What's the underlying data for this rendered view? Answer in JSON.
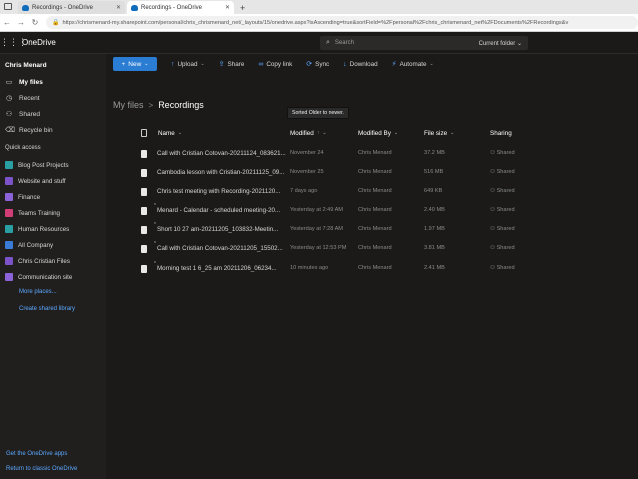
{
  "browser": {
    "tabs": [
      {
        "label": "Recordings - OneDrive",
        "active": false
      },
      {
        "label": "Recordings - OneDrive",
        "active": true
      }
    ],
    "new_tab": "+",
    "url": "https://chrismenard-my.sharepoint.com/personal/chris_chrismenard_net/_layouts/15/onedrive.aspx?isAscending=true&sortField=%2Fpersonal%2Fchris_chrismenard_net%2FDocuments%2FRecordings&v"
  },
  "suite": {
    "brand": "OneDrive",
    "search_placeholder": "Search",
    "search_scope": "Current folder"
  },
  "leftnav": {
    "user": "Chris Menard",
    "items": [
      {
        "label": "My files",
        "icon": "folder-icon",
        "selected": true
      },
      {
        "label": "Recent",
        "icon": "clock-icon",
        "selected": false
      },
      {
        "label": "Shared",
        "icon": "people-icon",
        "selected": false
      },
      {
        "label": "Recycle bin",
        "icon": "trash-icon",
        "selected": false
      }
    ],
    "quick_access_title": "Quick access",
    "quick_access": [
      {
        "label": "Blog Post Projects",
        "color": "#2aa0a4"
      },
      {
        "label": "Website and stuff",
        "color": "#7b52c8"
      },
      {
        "label": "Finance",
        "color": "#8b62d8"
      },
      {
        "label": "Teams Training",
        "color": "#d13d77"
      },
      {
        "label": "Human Resources",
        "color": "#2aa0a4"
      },
      {
        "label": "All Company",
        "color": "#3a7bd5"
      },
      {
        "label": "Chris Cristian Files",
        "color": "#7b52c8"
      },
      {
        "label": "Communication site",
        "color": "#8b62d8"
      }
    ],
    "more_places": "More places...",
    "create_library": "Create shared library",
    "get_apps": "Get the OneDrive apps",
    "return_classic": "Return to classic OneDrive"
  },
  "commands": {
    "new": "New",
    "upload": "Upload",
    "share": "Share",
    "copy_link": "Copy link",
    "sync": "Sync",
    "download": "Download",
    "automate": "Automate"
  },
  "breadcrumb": {
    "root": "My files",
    "separator": ">",
    "current": "Recordings"
  },
  "tooltip": "Sorted Older to newer.",
  "columns": {
    "name": "Name",
    "modified": "Modified",
    "modified_by": "Modified By",
    "file_size": "File size",
    "sharing": "Sharing"
  },
  "files": [
    {
      "name": "Call with Cristian Cotovan-20211124_083621...",
      "modified": "November 24",
      "modified_by": "Chris Menard",
      "size": "37.2 MB",
      "sharing": "Shared"
    },
    {
      "name": "Cambodia lesson with Cristian-20211125_09...",
      "modified": "November 25",
      "modified_by": "Chris Menard",
      "size": "516 MB",
      "sharing": "Shared"
    },
    {
      "name": "Chris test meeting with Recording-2021120...",
      "modified": "7 days ago",
      "modified_by": "Chris Menard",
      "size": "649 KB",
      "sharing": "Shared"
    },
    {
      "name": "Menard - Calendar - scheduled meeting-20...",
      "modified": "Yesterday at 2:49 AM",
      "modified_by": "Chris Menard",
      "size": "2.40 MB",
      "sharing": "Shared"
    },
    {
      "name": "Short 10 27 am-20211205_103832-Meetin...",
      "modified": "Yesterday at 7:28 AM",
      "modified_by": "Chris Menard",
      "size": "1.97 MB",
      "sharing": "Shared"
    },
    {
      "name": "Call with Cristian Cotovan-20211205_15502...",
      "modified": "Yesterday at 12:53 PM",
      "modified_by": "Chris Menard",
      "size": "3.81 MB",
      "sharing": "Shared"
    },
    {
      "name": "Morning test 1   6_25 am 20211206_06234...",
      "modified": "10 minutes ago",
      "modified_by": "Chris Menard",
      "size": "2.41 MB",
      "sharing": "Shared"
    }
  ]
}
